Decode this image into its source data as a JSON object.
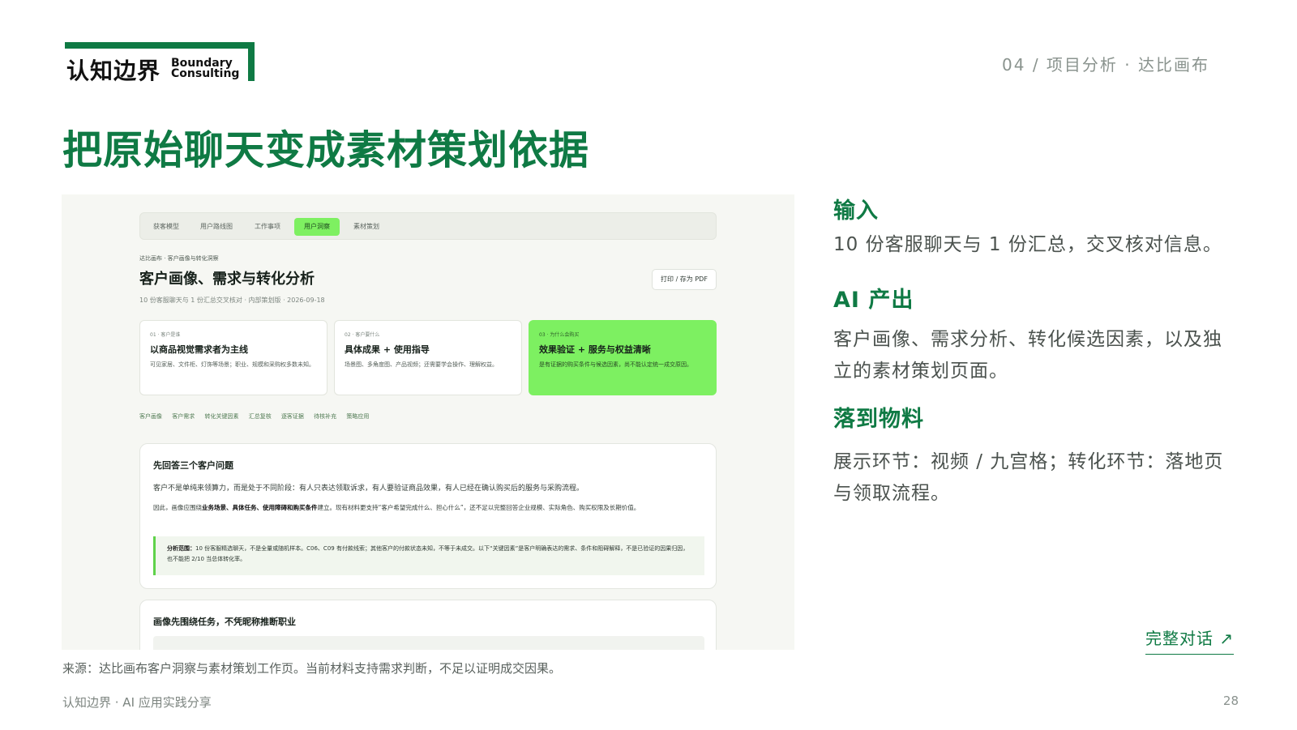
{
  "logo": {
    "cn": "认知边界",
    "en_line1": "Boundary",
    "en_line2": "Consulting"
  },
  "section_tag": "04 / 项目分析 · 达比画布",
  "title": "把原始聊天变成素材策划依据",
  "screenshot": {
    "tabs": [
      "获客模型",
      "用户路线图",
      "工作事项",
      "用户洞察",
      "素材策划"
    ],
    "active_tab": "用户洞察",
    "breadcrumb": "达比画布 · 客户画像与转化洞察",
    "page_title": "客户画像、需求与转化分析",
    "meta": "10 份客服聊天与 1 份汇总交叉核对 · 内部策划版 · 2026-09-18",
    "print_button": "打印 / 存为 PDF",
    "cards": [
      {
        "kicker": "01 · 客户是谁",
        "title": "以商品视觉需求者为主线",
        "text": "可见家居、文件柜、灯饰等场景；职业、规模和采购权多数未知。"
      },
      {
        "kicker": "02 · 客户要什么",
        "title": "具体成果 + 使用指导",
        "text": "场景图、多角度图、产品视频；还需要学会操作、理解权益。"
      },
      {
        "kicker": "03 · 为什么会购买",
        "title": "效果验证 + 服务与权益清晰",
        "text": "是有证据的购买条件与候选因素，尚不能认定统一成交原因。"
      }
    ],
    "subnav": [
      "客户画像",
      "客户需求",
      "转化关键因素",
      "汇总复核",
      "逐客证据",
      "待核补充",
      "策略应用"
    ],
    "panel1": {
      "heading": "先回答三个客户问题",
      "line1": "客户不是单纯来领算力，而是处于不同阶段：有人只表达领取诉求，有人要验证商品效果，有人已经在确认购买后的服务与采购流程。",
      "line2_pre": "因此，画像应围绕",
      "line2_bold": "业务场景、具体任务、使用障碍和购买条件",
      "line2_post": "建立。现有材料更支持“客户希望完成什么、担心什么”，还不足以完整回答企业规模、实际角色、购买权限及长期价值。",
      "quote_bold": "分析范围：",
      "quote_text": "10 份客服精选聊天，不是全量或随机样本。C06、C09 有付款线索；其他客户的付款状态未知，不等于未成交。以下“关键因素”是客户明确表达的需求、条件和阻碍解释，不是已验证的因果归因，也不能把 2/10 当总体转化率。"
    },
    "panel2": {
      "heading": "画像先围绕任务，不凭昵称推断职业"
    }
  },
  "right": {
    "input_heading": "输入",
    "input_text": "10 份客服聊天与 1 份汇总，交叉核对信息。",
    "ai_heading": "AI 产出",
    "ai_text": "客户画像、需求分析、转化候选因素，以及独立的素材策划页面。",
    "material_heading": "落到物料",
    "material_text": "展示环节：视频 / 九宫格；转化环节：落地页与领取流程。",
    "link_label": "完整对话 ↗"
  },
  "source": "来源：达比画布客户洞察与素材策划工作页。当前材料支持需求判断，不足以证明成交因果。",
  "footer": "认知边界 · AI 应用实践分享",
  "page_number": "28",
  "colors": {
    "brand_green": "#0f7a44",
    "highlight_green": "#7df061"
  }
}
